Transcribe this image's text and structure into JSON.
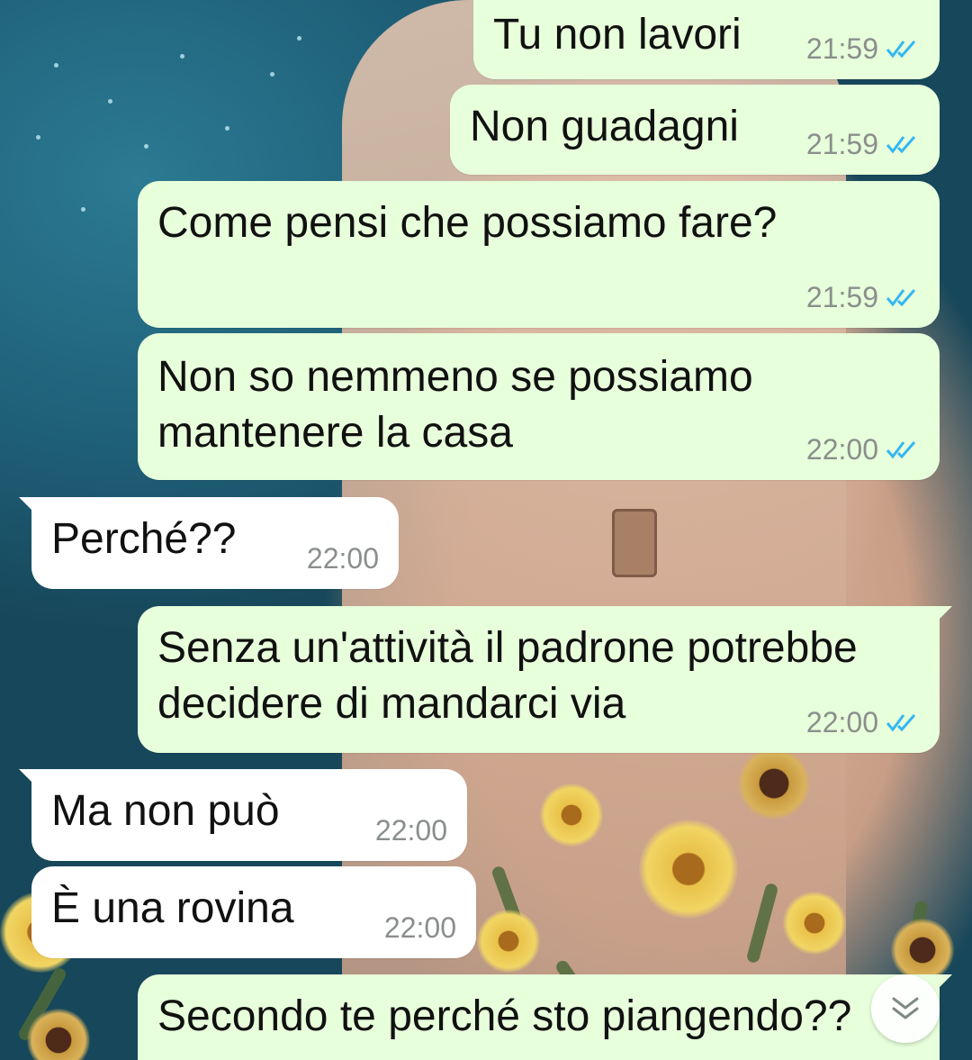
{
  "wallpaper": {
    "description_icon": "astronaut-flowers-wallpaper"
  },
  "colors": {
    "outgoing_bubble": "#e7ffdb",
    "incoming_bubble": "#ffffff",
    "read_ticks": "#34b7f1",
    "timestamp": "#8a8f8c"
  },
  "messages": [
    {
      "direction": "out",
      "text": "Tu non lavori",
      "time": "21:59",
      "status": "read"
    },
    {
      "direction": "out",
      "text": "Non guadagni",
      "time": "21:59",
      "status": "read"
    },
    {
      "direction": "out",
      "text": "Come pensi che possiamo fare?",
      "time": "21:59",
      "status": "read"
    },
    {
      "direction": "out",
      "text": "Non so nemmeno se possiamo\nmantenere la casa",
      "time": "22:00",
      "status": "read"
    },
    {
      "direction": "in",
      "text": "Perché??",
      "time": "22:00"
    },
    {
      "direction": "out",
      "text": "Senza un'attività il padrone potrebbe\ndecidere di mandarci via",
      "time": "22:00",
      "status": "read"
    },
    {
      "direction": "in",
      "text": "Ma non può",
      "time": "22:00"
    },
    {
      "direction": "in",
      "text": "È una rovina",
      "time": "22:00"
    },
    {
      "direction": "out",
      "text": "Secondo te perché sto piangendo??",
      "time": "",
      "status": ""
    }
  ],
  "scroll_down_button": {
    "icon": "chevron-double-down-icon"
  }
}
